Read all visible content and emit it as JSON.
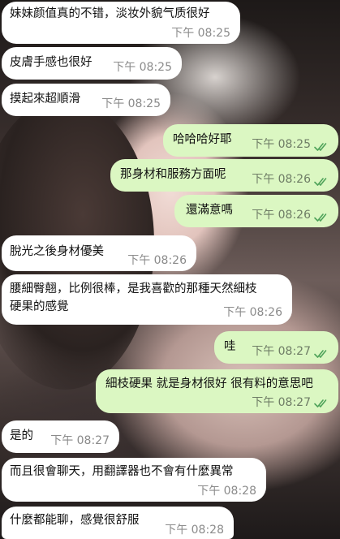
{
  "messages": [
    {
      "direction": "in",
      "text": "妹妹颜值真的不错，淡妆外貌气质很好",
      "time": "下午 08:25"
    },
    {
      "direction": "in",
      "text": "皮膚手感也很好",
      "time": "下午 08:25"
    },
    {
      "direction": "in",
      "text": "摸起來超順滑",
      "time": "下午 08:25"
    },
    {
      "direction": "out",
      "text": "哈哈哈好耶",
      "time": "下午 08:25",
      "status": "read"
    },
    {
      "direction": "out",
      "text": "那身材和服務方面呢",
      "time": "下午 08:26",
      "status": "read"
    },
    {
      "direction": "out",
      "text": "還滿意嗎",
      "time": "下午 08:26",
      "status": "read"
    },
    {
      "direction": "in",
      "text": "脫光之後身材優美",
      "time": "下午 08:26"
    },
    {
      "direction": "in",
      "text_line1": "腰細臀翹，比例很棒，是我喜歡的那種天然細枝",
      "text_line2": "硬果的感覺",
      "time": "下午 08:26"
    },
    {
      "direction": "out",
      "text": "哇",
      "time": "下午 08:27",
      "status": "read"
    },
    {
      "direction": "out",
      "text": "細枝硬果 就是身材很好 很有料的意思吧",
      "time": "下午 08:27",
      "status": "read"
    },
    {
      "direction": "in",
      "text": "是的",
      "time": "下午 08:27"
    },
    {
      "direction": "in",
      "text": "而且很會聊天，用翻譯器也不會有什麼異常",
      "time": "下午 08:28"
    },
    {
      "direction": "in",
      "text": "什麼都能聊，感覺很舒服",
      "time": "下午 08:28"
    }
  ],
  "colors": {
    "incoming": "#ffffff",
    "outgoing": "#dbf7c2",
    "read_ticks": "#4fa35a",
    "timestamp": "#8b8b8b"
  },
  "icons": {
    "read_receipt": "double-check-icon"
  }
}
